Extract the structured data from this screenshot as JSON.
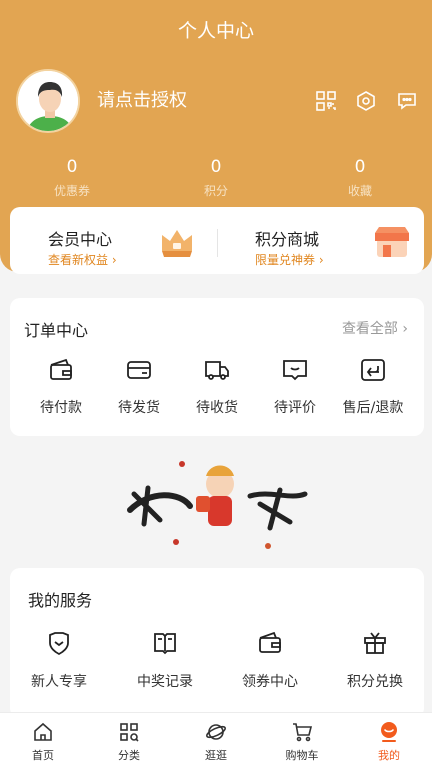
{
  "header": {
    "title": "个人中心",
    "login_prompt": "请点击授权",
    "icons": [
      "qrcode-icon",
      "settings-icon",
      "message-icon"
    ],
    "bg_color": "#e2a552"
  },
  "stats": [
    {
      "value": "0",
      "label": "优惠券"
    },
    {
      "value": "0",
      "label": "积分"
    },
    {
      "value": "0",
      "label": "收藏"
    }
  ],
  "member": {
    "left": {
      "title": "会员中心",
      "sub": "查看新权益 ›"
    },
    "right": {
      "title": "积分商城",
      "sub": "限量兑神券 ›"
    }
  },
  "orders": {
    "title": "订单中心",
    "view_all": "查看全部 ›",
    "items": [
      {
        "label": "待付款",
        "icon": "wallet-icon"
      },
      {
        "label": "待发货",
        "icon": "card-icon"
      },
      {
        "label": "待收货",
        "icon": "truck-icon"
      },
      {
        "label": "待评价",
        "icon": "comment-icon"
      },
      {
        "label": "售后/退款",
        "icon": "return-icon"
      }
    ]
  },
  "services": {
    "title": "我的服务",
    "items": [
      {
        "label": "新人专享",
        "icon": "badge-icon"
      },
      {
        "label": "中奖记录",
        "icon": "book-icon"
      },
      {
        "label": "领券中心",
        "icon": "wallet-icon"
      },
      {
        "label": "积分兑换",
        "icon": "gift-icon"
      }
    ]
  },
  "tabbar": {
    "items": [
      {
        "label": "首页",
        "icon": "home-icon"
      },
      {
        "label": "分类",
        "icon": "category-icon"
      },
      {
        "label": "逛逛",
        "icon": "planet-icon"
      },
      {
        "label": "购物车",
        "icon": "cart-icon"
      },
      {
        "label": "我的",
        "icon": "profile-icon"
      }
    ],
    "active_index": 4,
    "active_color": "#f25b1d"
  }
}
